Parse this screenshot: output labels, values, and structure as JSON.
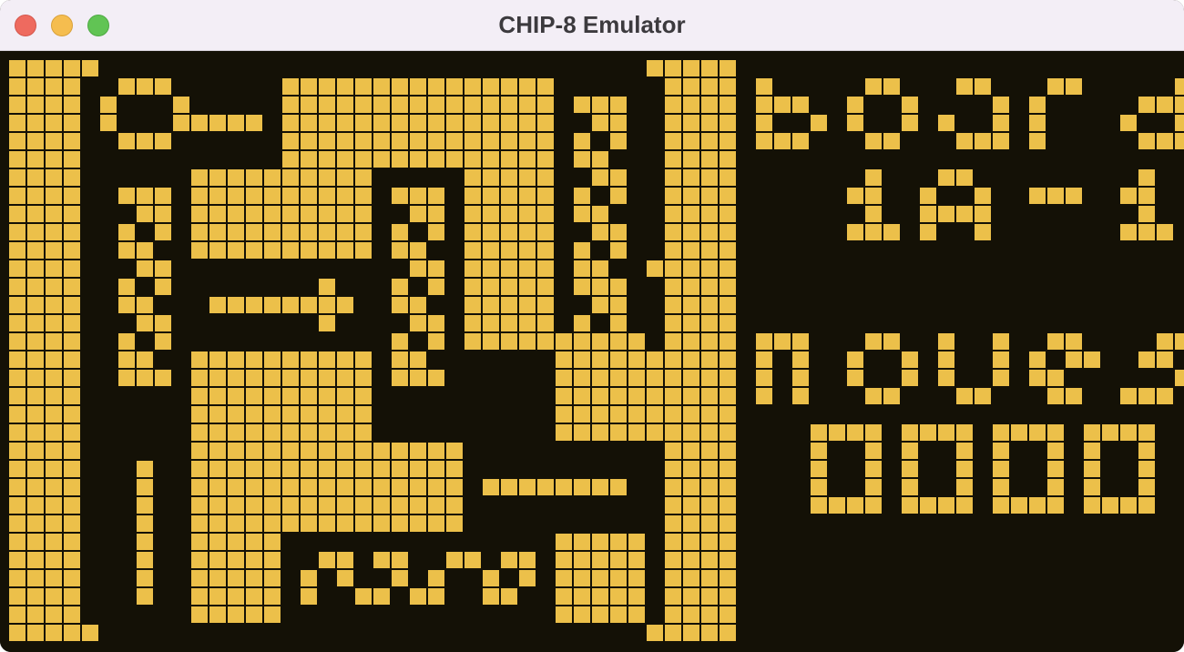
{
  "window": {
    "title": "CHIP-8 Emulator"
  },
  "game": {
    "board_label": "board",
    "board_id": "1A-1",
    "moves_label": "moves",
    "moves_count": "0000"
  },
  "colors": {
    "pixel_on": "#ecc04a",
    "background": "#141106"
  },
  "icons": [
    "close-icon",
    "minimize-icon",
    "zoom-icon"
  ]
}
